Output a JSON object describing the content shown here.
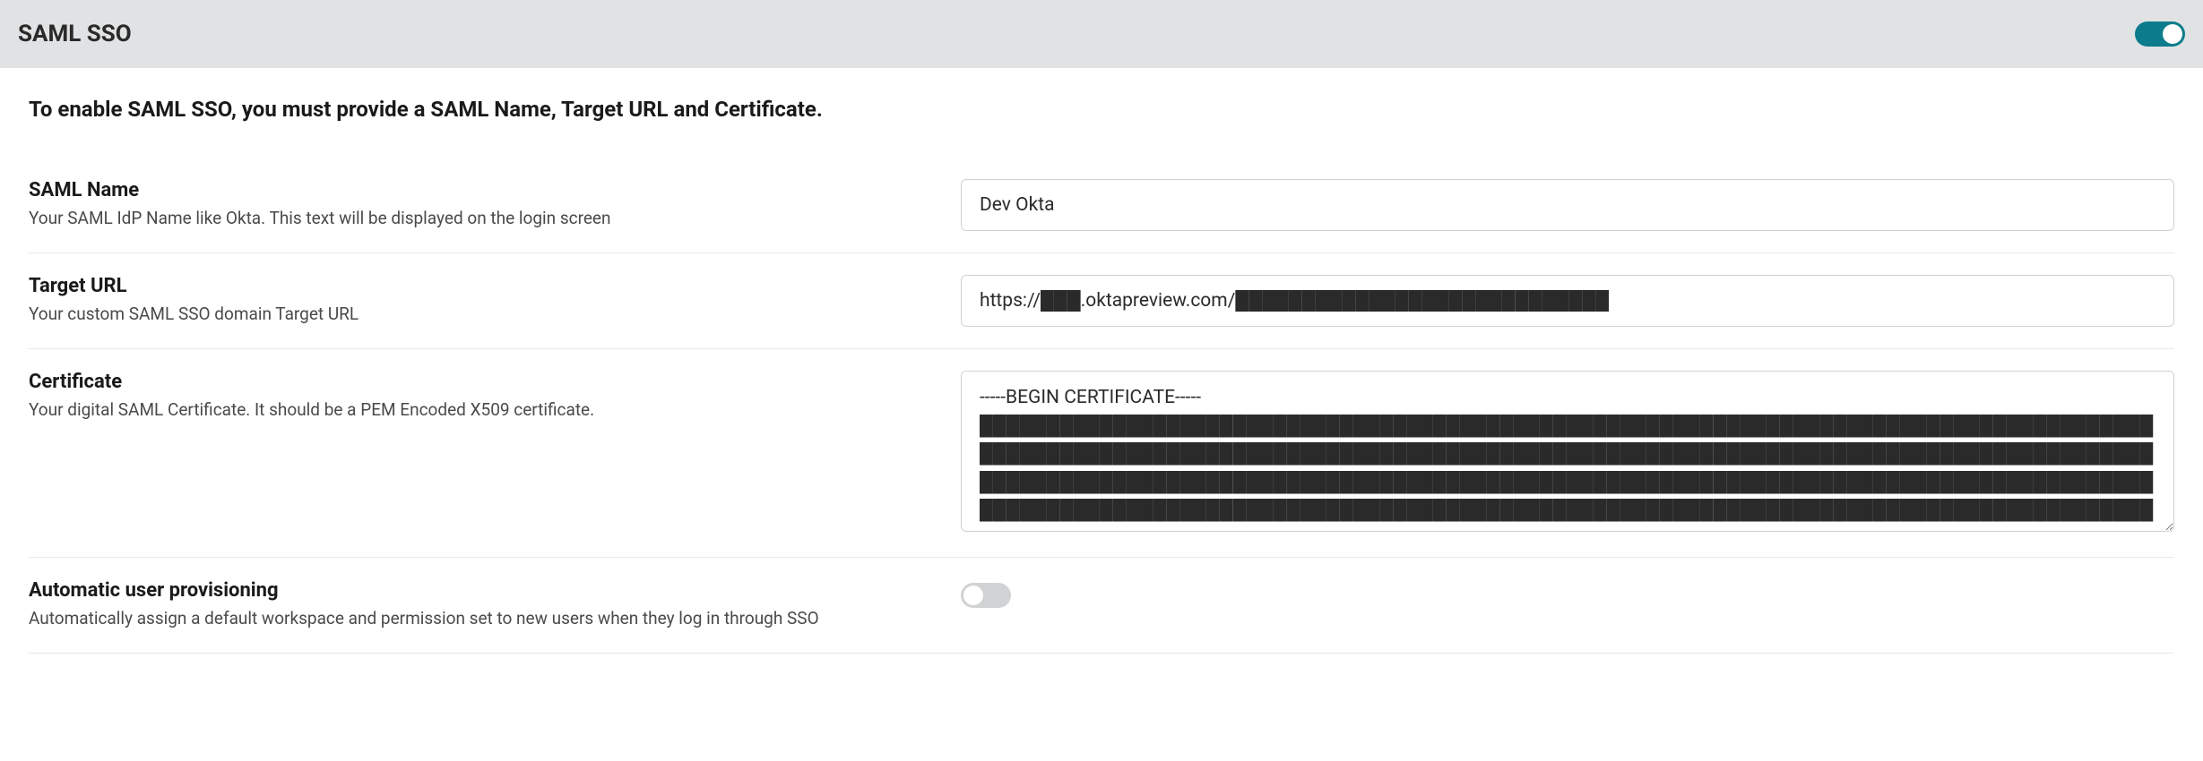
{
  "header": {
    "title": "SAML SSO",
    "sso_enabled": true
  },
  "instruction": "To enable SAML SSO, you must provide a SAML Name, Target URL and Certificate.",
  "fields": {
    "saml_name": {
      "label": "SAML Name",
      "description": "Your SAML IdP Name like Okta. This text will be displayed on the login screen",
      "value": "Dev Okta"
    },
    "target_url": {
      "label": "Target URL",
      "description": "Your custom SAML SSO domain Target URL",
      "value": "https://███.oktapreview.com/████████████████████████████"
    },
    "certificate": {
      "label": "Certificate",
      "description": "Your digital SAML Certificate. It should be a PEM Encoded X509 certificate.",
      "value": "-----BEGIN CERTIFICATE-----\n████████████████████████████████████████████████████████████████████████████████████████\n████████████████████████████████████████████████████████████████████████████████████████\n████████████████████████████████████████████████████████████████████████████████████████\n████████████████████████████████████████████████████████████████████████████████████████"
    },
    "auto_provisioning": {
      "label": "Automatic user provisioning",
      "description": "Automatically assign a default workspace and permission set to new users when they log in through SSO",
      "enabled": false
    }
  }
}
